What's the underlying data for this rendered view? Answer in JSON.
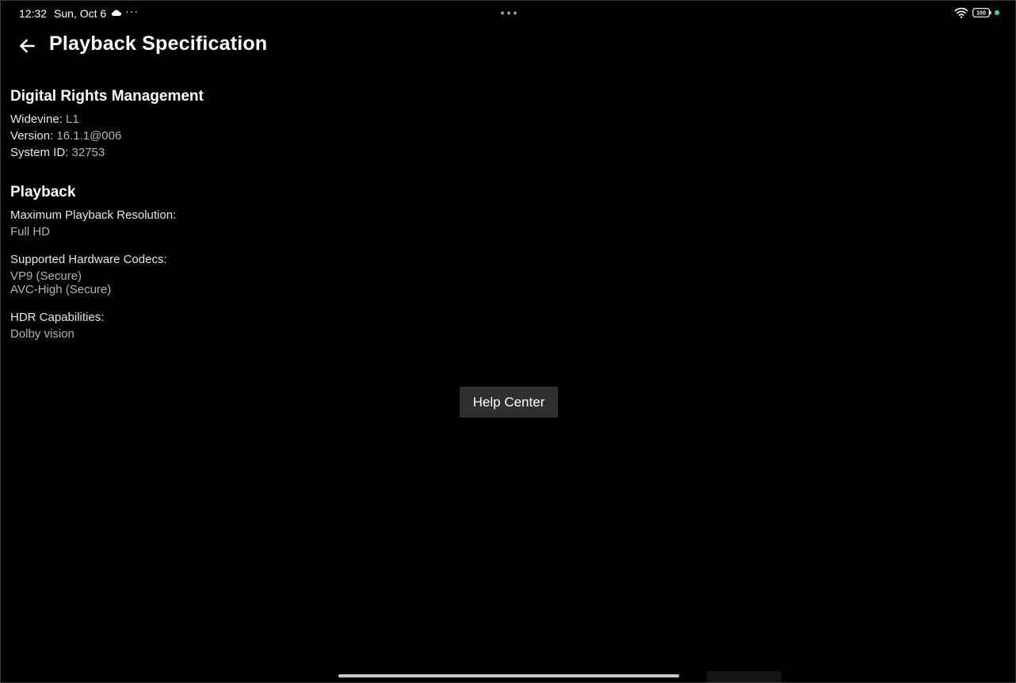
{
  "status_bar": {
    "time": "12:32",
    "date": "Sun, Oct 6",
    "more": "···",
    "battery": "100",
    "icons": [
      "cloud-icon",
      "wifi-icon",
      "battery-icon"
    ],
    "indicator_color": "#3ddc84"
  },
  "header": {
    "back_icon": "arrow-left-icon",
    "title": "Playback Specification"
  },
  "drm": {
    "title": "Digital Rights Management",
    "widevine_label": "Widevine:",
    "widevine_value": "L1",
    "version_label": "Version:",
    "version_value": "16.1.1@006",
    "system_id_label": "System ID:",
    "system_id_value": "32753"
  },
  "playback": {
    "title": "Playback",
    "max_res_label": "Maximum Playback Resolution:",
    "max_res_value": "Full HD",
    "codecs_label": "Supported Hardware Codecs:",
    "codecs": [
      "VP9 (Secure)",
      "AVC-High (Secure)"
    ],
    "hdr_label": "HDR Capabilities:",
    "hdr_value": "Dolby vision"
  },
  "help_button": {
    "label": "Help Center",
    "background": "#2f2f2f"
  }
}
